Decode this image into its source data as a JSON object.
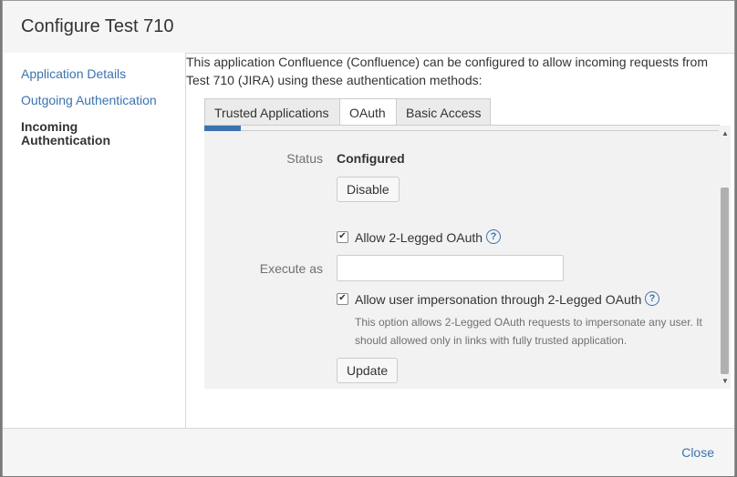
{
  "dialog": {
    "title": "Configure Test 710"
  },
  "sidebar": {
    "items": [
      {
        "label": "Application Details"
      },
      {
        "label": "Outgoing Authentication"
      },
      {
        "label": "Incoming Authentication"
      }
    ]
  },
  "content": {
    "intro": "This application Confluence (Confluence) can be configured to allow incoming requests from Test 710 (JIRA) using these authentication methods:",
    "tabs": [
      {
        "label": "Trusted Applications"
      },
      {
        "label": "OAuth"
      },
      {
        "label": "Basic Access"
      }
    ],
    "active_tab": "OAuth"
  },
  "oauth": {
    "status_label": "Status",
    "status_value": "Configured",
    "disable_label": "Disable",
    "allow_2legged_label": "Allow 2-Legged OAuth",
    "allow_2legged_checked": true,
    "execute_as_label": "Execute as",
    "execute_as_value": "",
    "impersonation_label": "Allow user impersonation through 2-Legged OAuth",
    "impersonation_checked": true,
    "impersonation_desc": "This option allows 2-Legged OAuth requests to impersonate any user. It should allowed only in links with fully trusted application.",
    "update_label": "Update"
  },
  "footer": {
    "close_label": "Close"
  },
  "colors": {
    "link": "#3b73af",
    "progress": "#3b73af"
  },
  "icons": {
    "help": "help-circle-icon",
    "check": "checkmark-icon"
  }
}
